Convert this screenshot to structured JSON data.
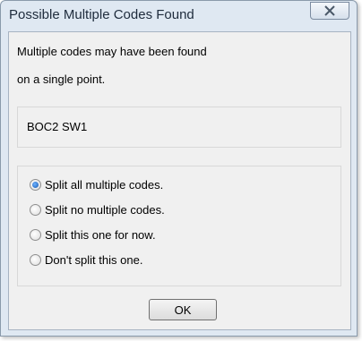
{
  "window": {
    "title": "Possible Multiple Codes Found"
  },
  "message": {
    "line1": "Multiple codes may have been found",
    "line2": "on a single point."
  },
  "code": {
    "value": "BOC2 SW1"
  },
  "options": [
    {
      "label": "Split all multiple codes.",
      "selected": true
    },
    {
      "label": "Split no multiple codes.",
      "selected": false
    },
    {
      "label": "Split this one for now.",
      "selected": false
    },
    {
      "label": "Don't split this one.",
      "selected": false
    }
  ],
  "buttons": {
    "ok_label": "OK"
  },
  "colors": {
    "frame": "#dfe8f2",
    "client": "#f0f0f0",
    "radio_selected": "#1558b0"
  }
}
